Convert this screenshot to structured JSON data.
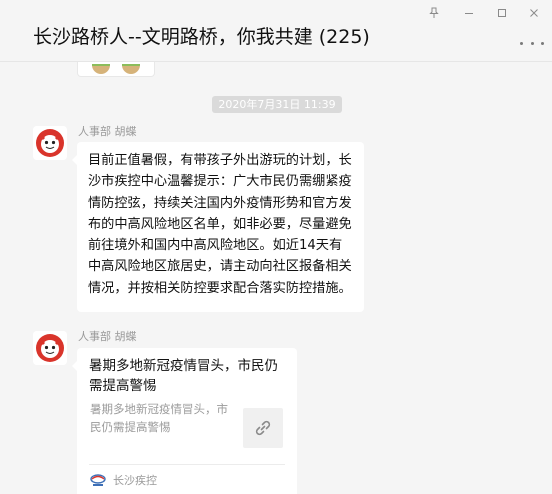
{
  "window": {
    "title": "长沙路桥人--文明路桥，你我共建 (225)",
    "controls": {
      "pin_icon": "pin-icon",
      "min_icon": "minimize-icon",
      "max_icon": "maximize-icon",
      "close_icon": "close-icon"
    }
  },
  "chat": {
    "timestamp": "2020年7月31日 11:39",
    "messages": [
      {
        "sender": "人事部 胡蝶",
        "type": "text",
        "text": "目前正值暑假，有带孩子外出游玩的计划，长沙市疾控中心温馨提示：广大市民仍需绷紧疫情防控弦，持续关注国内外疫情形势和官方发布的中高风险地区名单，如非必要，尽量避免前往境外和国内中高风险地区。如近14天有中高风险地区旅居史，请主动向社区报备相关情况，并按相关防控要求配合落实防控措施。"
      },
      {
        "sender": "人事部 胡蝶",
        "type": "link-card",
        "card_title": "暑期多地新冠疫情冒头，市民仍需提高警惕",
        "card_desc": "暑期多地新冠疫情冒头，市民仍需提高警惕",
        "source": "长沙疾控",
        "thumb_icon": "link-icon"
      }
    ]
  },
  "colors": {
    "background": "#f5f5f5",
    "bubble": "#ffffff",
    "timestamp_bg": "#dadada",
    "muted_text": "#9b9b9b"
  }
}
